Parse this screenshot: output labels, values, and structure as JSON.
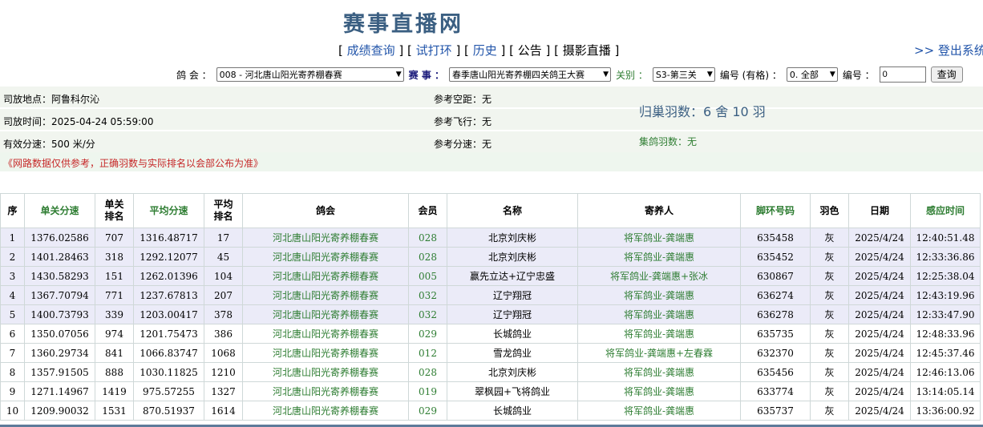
{
  "site": {
    "title": "赛事直播网"
  },
  "nav": [
    {
      "label": "成绩查询"
    },
    {
      "label": "试打环"
    },
    {
      "label": "历史"
    },
    {
      "label": "公告"
    },
    {
      "label": "摄影直播"
    }
  ],
  "logout": {
    "label": ">> 登出系统"
  },
  "filters": {
    "club_label": "鸽 会 ：",
    "club_value": "008 - 河北唐山阳光寄养棚春赛",
    "race_label": "赛 事 ：",
    "race_value": "春季唐山阳光寄养棚四关鸽王大赛",
    "stage_label": "关别 ：",
    "stage_value": "S3-第三关",
    "ring_label": "编号 (有格) ：",
    "ring_value": "0. 全部",
    "number_label": "编号 ：",
    "number_value": "0",
    "search_button": "查询"
  },
  "info": {
    "release_place": "司放地点：阿鲁科尔沁",
    "release_time": "司放时间：2025-04-24 05:59:00",
    "effective_speed": "有效分速：500 米/分",
    "ref_distance": "参考空距：无",
    "ref_flight": "参考飞行：无",
    "ref_speed": "参考分速：无",
    "returned": "归巢羽数：6 舍 10 羽",
    "pigeon_count": "集鸽羽数：无",
    "notice": "《网路数据仅供参考，正确羽数与实际排名以会部公布为准》"
  },
  "table": {
    "headers": [
      "序",
      "单关分速",
      "单关\n排名",
      "平均分速",
      "平均\n排名",
      "鸽会",
      "会员",
      "名称",
      "寄养人",
      "脚环号码",
      "羽色",
      "日期",
      "感应时间"
    ],
    "rows": [
      [
        "1",
        "1376.02586",
        "707",
        "1316.48717",
        "17",
        "河北唐山阳光寄养棚春赛",
        "028",
        "北京刘庆彬",
        "将军鸽业-龚端惠",
        "635458",
        "灰",
        "2025/4/24",
        "12:40:51.48"
      ],
      [
        "2",
        "1401.28463",
        "318",
        "1292.12077",
        "45",
        "河北唐山阳光寄养棚春赛",
        "028",
        "北京刘庆彬",
        "将军鸽业-龚端惠",
        "635452",
        "灰",
        "2025/4/24",
        "12:33:36.86"
      ],
      [
        "3",
        "1430.58293",
        "151",
        "1262.01396",
        "104",
        "河北唐山阳光寄养棚春赛",
        "005",
        "赢先立达+辽宁忠盛",
        "将军鸽业-龚端惠+张冰",
        "630867",
        "灰",
        "2025/4/24",
        "12:25:38.04"
      ],
      [
        "4",
        "1367.70794",
        "771",
        "1237.67813",
        "207",
        "河北唐山阳光寄养棚春赛",
        "032",
        "辽宁翔冠",
        "将军鸽业-龚端惠",
        "636274",
        "灰",
        "2025/4/24",
        "12:43:19.96"
      ],
      [
        "5",
        "1400.73793",
        "339",
        "1203.00417",
        "378",
        "河北唐山阳光寄养棚春赛",
        "032",
        "辽宁翔冠",
        "将军鸽业-龚端惠",
        "636278",
        "灰",
        "2025/4/24",
        "12:33:47.90"
      ],
      [
        "6",
        "1350.07056",
        "974",
        "1201.75473",
        "386",
        "河北唐山阳光寄养棚春赛",
        "029",
        "长城鸽业",
        "将军鸽业-龚端惠",
        "635735",
        "灰",
        "2025/4/24",
        "12:48:33.96"
      ],
      [
        "7",
        "1360.29734",
        "841",
        "1066.83747",
        "1068",
        "河北唐山阳光寄养棚春赛",
        "012",
        "雪龙鸽业",
        "将军鸽业-龚端惠+左春霖",
        "632370",
        "灰",
        "2025/4/24",
        "12:45:37.46"
      ],
      [
        "8",
        "1357.91505",
        "888",
        "1030.11825",
        "1210",
        "河北唐山阳光寄养棚春赛",
        "028",
        "北京刘庆彬",
        "将军鸽业-龚端惠",
        "635456",
        "灰",
        "2025/4/24",
        "12:46:13.06"
      ],
      [
        "9",
        "1271.14967",
        "1419",
        "975.57255",
        "1327",
        "河北唐山阳光寄养棚春赛",
        "019",
        "翠枫园+飞将鸽业",
        "将军鸽业-龚端惠",
        "633774",
        "灰",
        "2025/4/24",
        "13:14:05.14"
      ],
      [
        "10",
        "1209.90032",
        "1531",
        "870.51937",
        "1614",
        "河北唐山阳光寄养棚春赛",
        "029",
        "长城鸽业",
        "将军鸽业-龚端惠",
        "635737",
        "灰",
        "2025/4/24",
        "13:36:00.92"
      ]
    ]
  }
}
